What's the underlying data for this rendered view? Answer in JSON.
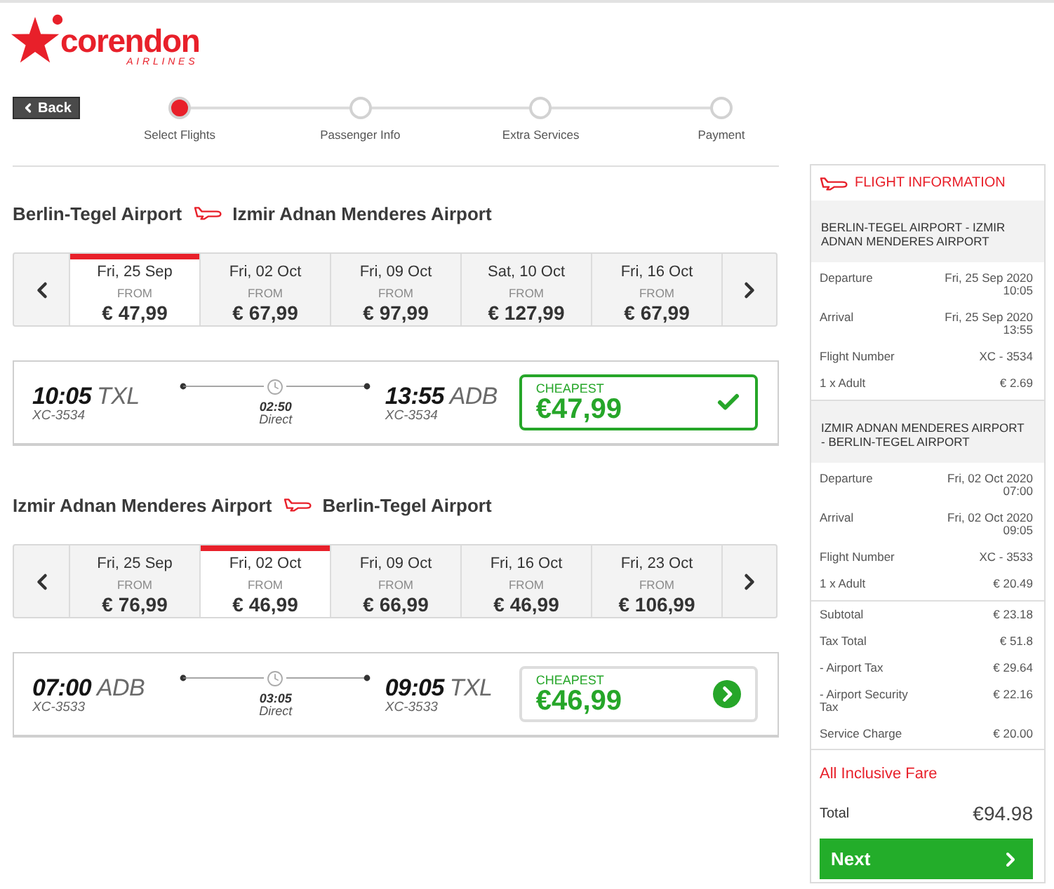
{
  "logo": {
    "wordmark": "corendon",
    "tagline": "AIRLINES"
  },
  "back_button": {
    "label": "Back"
  },
  "steps": [
    {
      "label": "Select Flights",
      "selected": true
    },
    {
      "label": "Passenger Info",
      "selected": false
    },
    {
      "label": "Extra Services",
      "selected": false
    },
    {
      "label": "Payment",
      "selected": false
    }
  ],
  "legs": [
    {
      "origin": "Berlin-Tegel Airport",
      "destination": "Izmir Adnan Menderes Airport",
      "dates": [
        {
          "date": "Fri, 25 Sep",
          "caption": "FROM",
          "price": "€ 47,99",
          "selected": true
        },
        {
          "date": "Fri, 02 Oct",
          "caption": "FROM",
          "price": "€ 67,99",
          "selected": false
        },
        {
          "date": "Fri, 09 Oct",
          "caption": "FROM",
          "price": "€ 97,99",
          "selected": false
        },
        {
          "date": "Sat, 10 Oct",
          "caption": "FROM",
          "price": "€ 127,99",
          "selected": false
        },
        {
          "date": "Fri, 16 Oct",
          "caption": "FROM",
          "price": "€ 67,99",
          "selected": false
        }
      ],
      "flight": {
        "departure": {
          "time": "10:05",
          "airport": "TXL",
          "flight_number": "XC-3534"
        },
        "duration": "02:50",
        "stops": "Direct",
        "arrival": {
          "time": "13:55",
          "airport": "ADB",
          "flight_number": "XC-3534"
        },
        "fare": {
          "badge": "CHEAPEST",
          "price": "€47,99",
          "selected": true
        }
      }
    },
    {
      "origin": "Izmir Adnan Menderes Airport",
      "destination": "Berlin-Tegel Airport",
      "dates": [
        {
          "date": "Fri, 25 Sep",
          "caption": "FROM",
          "price": "€ 76,99",
          "selected": false
        },
        {
          "date": "Fri, 02 Oct",
          "caption": "FROM",
          "price": "€ 46,99",
          "selected": true
        },
        {
          "date": "Fri, 09 Oct",
          "caption": "FROM",
          "price": "€ 66,99",
          "selected": false
        },
        {
          "date": "Fri, 16 Oct",
          "caption": "FROM",
          "price": "€ 46,99",
          "selected": false
        },
        {
          "date": "Fri, 23 Oct",
          "caption": "FROM",
          "price": "€ 106,99",
          "selected": false
        }
      ],
      "flight": {
        "departure": {
          "time": "07:00",
          "airport": "ADB",
          "flight_number": "XC-3533"
        },
        "duration": "03:05",
        "stops": "Direct",
        "arrival": {
          "time": "09:05",
          "airport": "TXL",
          "flight_number": "XC-3533"
        },
        "fare": {
          "badge": "CHEAPEST",
          "price": "€46,99",
          "selected": false
        }
      }
    }
  ],
  "flight_information": {
    "title": "FLIGHT INFORMATION",
    "legs": [
      {
        "route": "BERLIN-TEGEL AIRPORT - IZMIR ADNAN MENDERES AIRPORT",
        "rows": [
          {
            "label": "Departure",
            "value": "Fri, 25 Sep 2020 10:05"
          },
          {
            "label": "Arrival",
            "value": "Fri, 25 Sep 2020 13:55"
          },
          {
            "label": "Flight Number",
            "value": "XC - 3534"
          },
          {
            "label": "1 x Adult",
            "value": "€ 2.69"
          }
        ]
      },
      {
        "route": "IZMIR ADNAN MENDERES AIRPORT - BERLIN-TEGEL AIRPORT",
        "rows": [
          {
            "label": "Departure",
            "value": "Fri, 02 Oct 2020 07:00"
          },
          {
            "label": "Arrival",
            "value": "Fri, 02 Oct 2020 09:05"
          },
          {
            "label": "Flight Number",
            "value": "XC - 3533"
          },
          {
            "label": "1 x Adult",
            "value": "€ 20.49"
          }
        ]
      }
    ],
    "charges": [
      {
        "label": "Subtotal",
        "value": "€ 23.18"
      },
      {
        "label": "Tax Total",
        "value": "€ 51.8"
      },
      {
        "label": "- Airport Tax",
        "value": "€ 29.64"
      },
      {
        "label": "- Airport Security Tax",
        "value": "€ 22.16"
      },
      {
        "label": "Service Charge",
        "value": "€ 20.00"
      }
    ],
    "fare_note": "All Inclusive Fare",
    "total": {
      "label": "Total",
      "value": "€94.98"
    },
    "next_button": {
      "label": "Next"
    }
  }
}
